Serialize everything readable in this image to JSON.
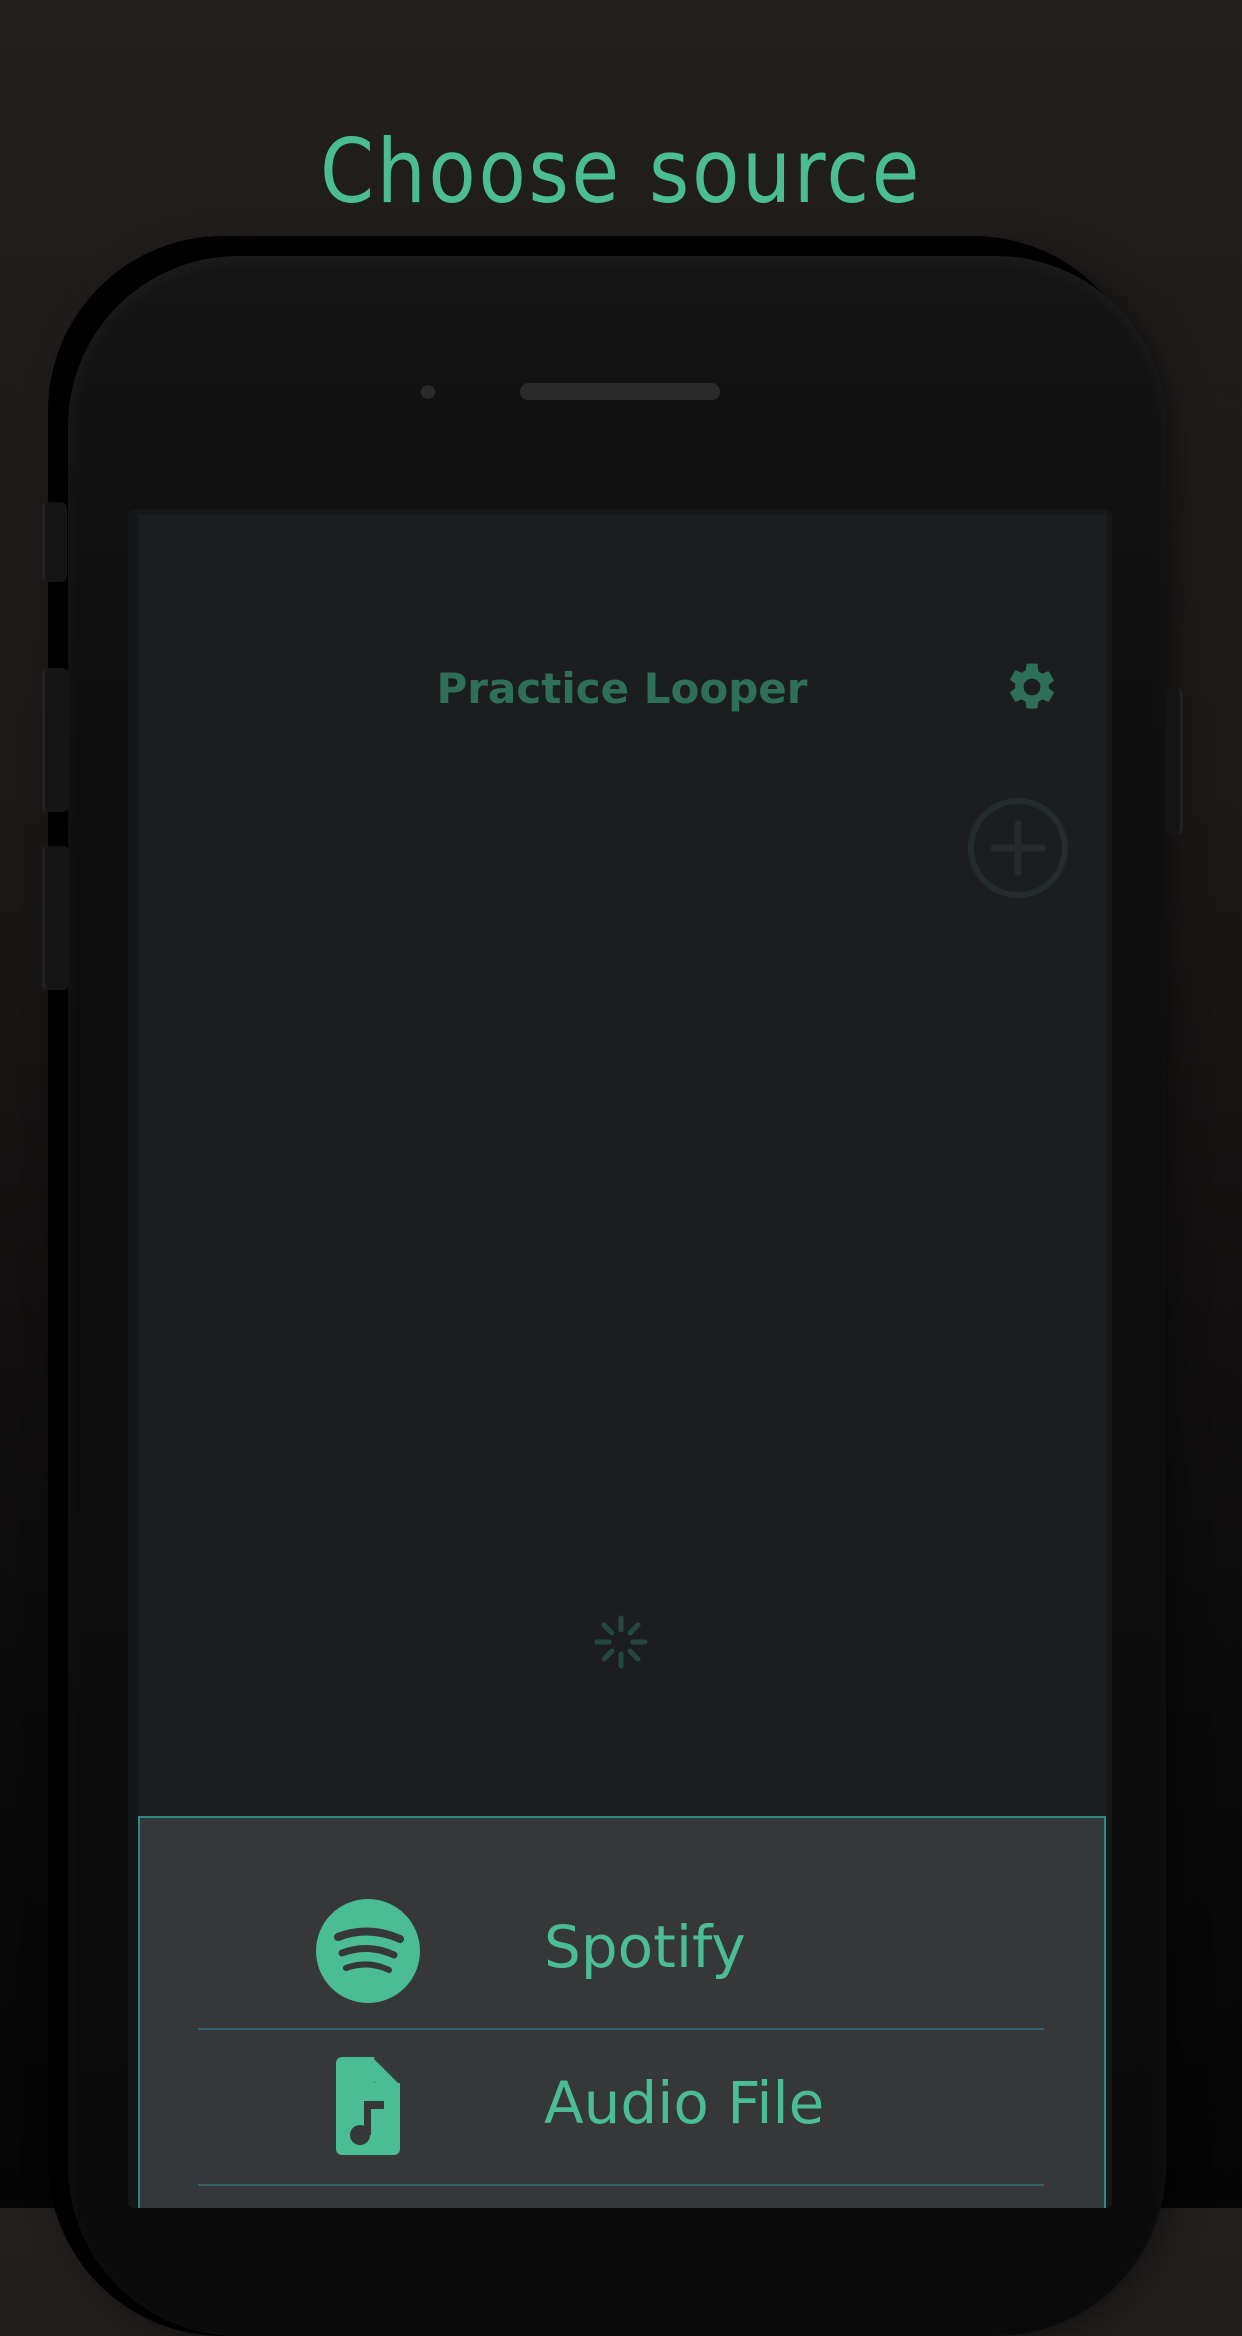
{
  "headline": "Choose source",
  "app": {
    "title": "Practice Looper",
    "settings_icon": "gear-icon",
    "add_icon": "add-circle-icon",
    "loading_icon": "spinner-icon"
  },
  "source_sheet": {
    "items": [
      {
        "label": "Spotify",
        "icon": "spotify-icon"
      },
      {
        "label": "Audio File",
        "icon": "audio-file-icon"
      }
    ]
  },
  "colors": {
    "accent": "#4bbd95",
    "accent_dim": "#2e6f59",
    "screen_bg": "#1c1d1f",
    "sheet_bg": "#363738",
    "sheet_border": "#2a8a86"
  }
}
